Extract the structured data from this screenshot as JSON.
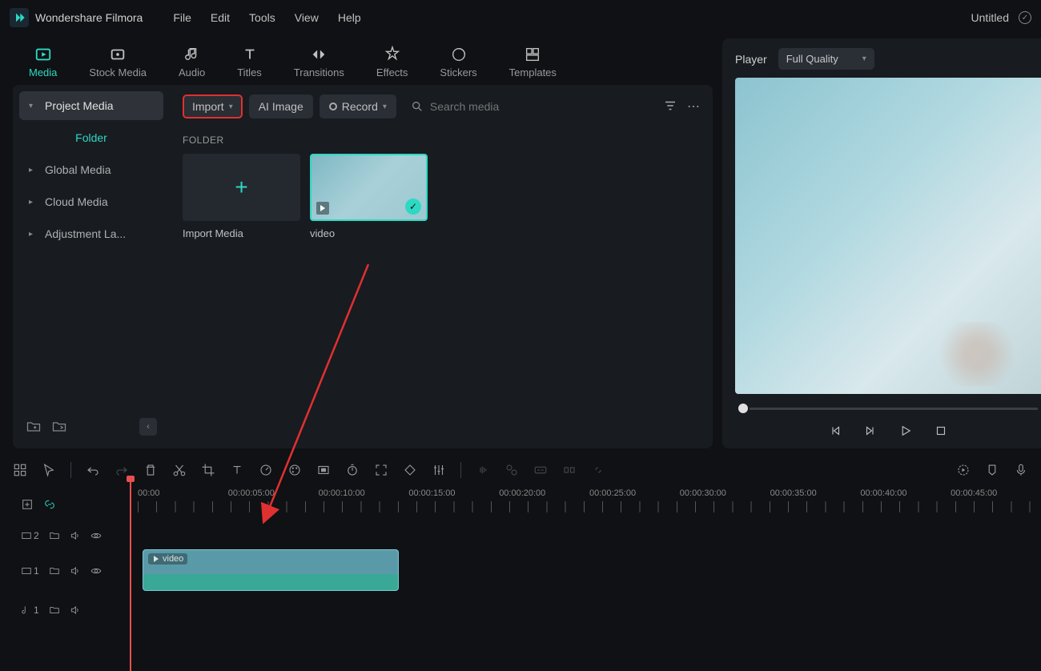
{
  "titlebar": {
    "app_name": "Wondershare Filmora",
    "menu": [
      "File",
      "Edit",
      "Tools",
      "View",
      "Help"
    ],
    "project_title": "Untitled"
  },
  "tabs": [
    {
      "label": "Media",
      "active": true
    },
    {
      "label": "Stock Media",
      "active": false
    },
    {
      "label": "Audio",
      "active": false
    },
    {
      "label": "Titles",
      "active": false
    },
    {
      "label": "Transitions",
      "active": false
    },
    {
      "label": "Effects",
      "active": false
    },
    {
      "label": "Stickers",
      "active": false
    },
    {
      "label": "Templates",
      "active": false
    }
  ],
  "sidebar": {
    "items": [
      {
        "label": "Project Media",
        "selected": true
      },
      {
        "label": "Global Media",
        "selected": false
      },
      {
        "label": "Cloud Media",
        "selected": false
      },
      {
        "label": "Adjustment La...",
        "selected": false
      }
    ],
    "folder_link": "Folder"
  },
  "toolbar": {
    "import": "Import",
    "ai_image": "AI Image",
    "record": "Record",
    "search_placeholder": "Search media"
  },
  "content": {
    "section_label": "FOLDER",
    "import_card": "Import Media",
    "video_card": "video"
  },
  "player": {
    "title": "Player",
    "quality": "Full Quality"
  },
  "timeline": {
    "ruler": [
      "00:00",
      "00:00:05:00",
      "00:00:10:00",
      "00:00:15:00",
      "00:00:20:00",
      "00:00:25:00",
      "00:00:30:00",
      "00:00:35:00",
      "00:00:40:00",
      "00:00:45:00"
    ],
    "track2_label": "2",
    "track1_label": "1",
    "audio_label": "1",
    "clip_label": "video"
  }
}
